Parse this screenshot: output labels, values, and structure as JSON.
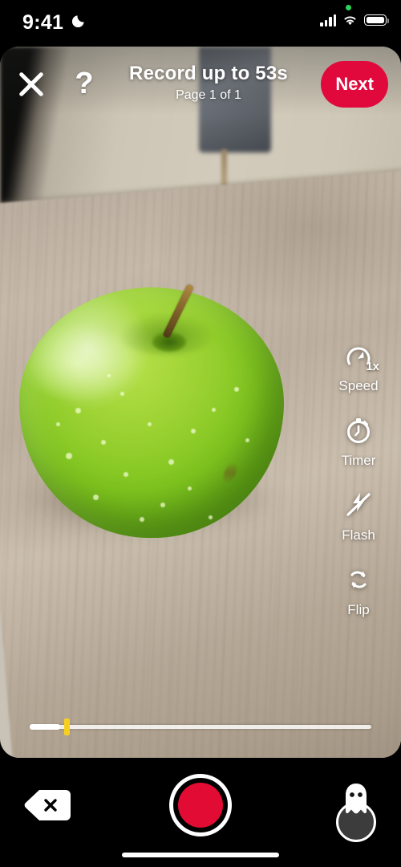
{
  "status_bar": {
    "time": "9:41",
    "dnd_icon": "moon-icon",
    "privacy_indicator": "green-recording-dot",
    "signal_icon": "cellular-signal-icon",
    "signal_bars": 4,
    "wifi_icon": "wifi-icon",
    "battery_icon": "battery-full-icon",
    "battery_level": "100"
  },
  "header": {
    "close_label": "close-icon",
    "help_label": "?",
    "title": "Record up to 53s",
    "subtitle": "Page 1 of 1",
    "next_label": "Next",
    "next_color": "#E1093C"
  },
  "camera": {
    "scene_description": "green apple on wooden table",
    "apple_color": "#8FCB2A",
    "table_color": "#BFB2A2",
    "wall_color": "#CDC6B6"
  },
  "controls": [
    {
      "id": "speed",
      "label": "Speed",
      "icon": "speedometer-icon",
      "value": "1x"
    },
    {
      "id": "timer",
      "label": "Timer",
      "icon": "stopwatch-icon",
      "value": ""
    },
    {
      "id": "flash",
      "label": "Flash",
      "icon": "flash-off-icon",
      "value": ""
    },
    {
      "id": "flip",
      "label": "Flip",
      "icon": "camera-flip-icon",
      "value": ""
    }
  ],
  "timeline": {
    "recorded_percent": 9,
    "marker_percent": 10,
    "track_color": "#FFFFFF",
    "marker_color": "#F5D020"
  },
  "bottom_bar": {
    "delete_icon": "delete-backspace-icon",
    "record_icon": "record-button",
    "record_color": "#E10B33",
    "effects_icon": "ghost-effects-icon",
    "home_indicator": "home-indicator"
  }
}
